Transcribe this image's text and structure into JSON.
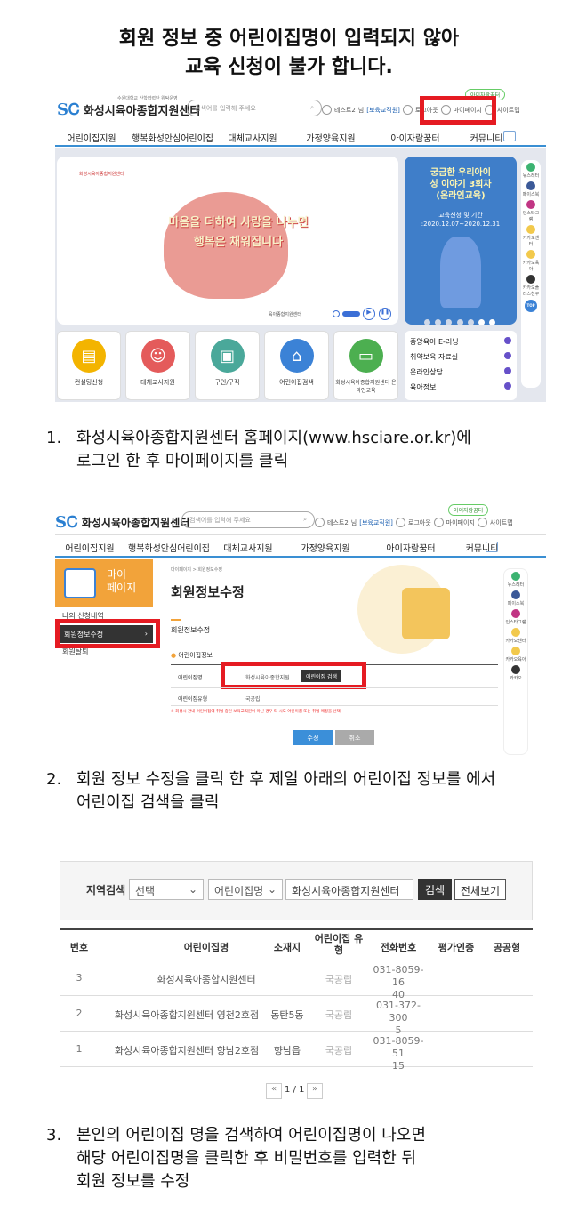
{
  "heading": {
    "line1": "회원 정보 중 어린이집명이 입력되지 않아",
    "line2": "교육 신청이 불가 합니다."
  },
  "site": {
    "logo_name": "화성시육아종합지원센터",
    "logo_tagline": "수원대학교 산학협력단 위탁운영",
    "search_placeholder": "검색어를 입력해 주세요",
    "user_name": "테스트2",
    "user_suffix": "님",
    "user_role": "[보육교직원]",
    "logout": "로그아웃",
    "mypage": "마이페이지",
    "sitemap": "사이트맵",
    "top_tag": "아이자람꿈터",
    "nav": [
      "어린이집지원",
      "행복화성안심어린이집",
      "대체교사지원",
      "가정양육지원",
      "아이자람꿈터",
      "커뮤니티"
    ]
  },
  "home": {
    "banner_logo": "화성시육아종합지원센터",
    "banner_line1": "마음을 더하여 사랑을 나누면",
    "banner_line2": "행복은 채워집니다",
    "banner_footer": "육아종합지원센터",
    "promo_line1": "궁금한 우리아이",
    "promo_line2": "성 이야기 3회차",
    "promo_line3": "(온라인교육)",
    "promo_period_label": "교육신청 및 기간",
    "promo_period": ":2020.12.07~2020.12.31",
    "quick": [
      "컨설팅신청",
      "대체교사지원",
      "구인/구직",
      "어린이집검색",
      "화성시육아종합지원센터 온라인교육"
    ],
    "side_links": [
      "중앙육아 E-러닝",
      "취약보육 자료실",
      "온라인상담",
      "육아정보"
    ],
    "right_bar": [
      "뉴스레터",
      "페이스북",
      "인스타그램",
      "카카오센터",
      "카카오육아",
      "카카오플러스친구",
      "TOP"
    ]
  },
  "step1": {
    "num": "1.",
    "line1": "화성시육아종합지원센터 홈페이지(www.hsciare.or.kr)에",
    "line2": "로그인 한 후 마이페이지를 클릭"
  },
  "mypage": {
    "side_title_1": "마이",
    "side_title_2": "페이지",
    "side_items": [
      "나의 신청내역",
      "회원정보수정",
      "회원탈퇴"
    ],
    "breadcrumb": "마이페이지  >  회원정보수정",
    "page_title": "회원정보수정",
    "section_title": "회원정보수정",
    "subsection": "어린이집정보",
    "field1_label": "어린이집명",
    "field1_value": "화성시육아종합지원",
    "field1_button": "어린이집 검색",
    "field2_label": "어린이집유형",
    "field2_value": "국공립",
    "notice": "※ 화성시 관내 어린이집에 취업 중인 보육교직원이 아닌 경우 타 시도 어린이집 또는 취업 예정을 선택",
    "submit": "수정",
    "cancel": "취소",
    "right_bar": [
      "뉴스레터",
      "페이스북",
      "인스타그램",
      "카카오센터",
      "카카오육아",
      "카카오"
    ]
  },
  "step2": {
    "num": "2.",
    "line1": "회원 정보 수정을 클릭 한 후 제일 아래의 어린이집 정보를 에서",
    "line2": "어린이집 검색을 클릭"
  },
  "search_panel": {
    "region_label": "지역검색",
    "region_select": "선택",
    "type_select": "어린이집명",
    "keyword": "화성시육아종합지원센터",
    "search_button": "검색",
    "all_button": "전체보기",
    "headers": [
      "번호",
      "어린이집명",
      "소재지",
      "어린이집 유형",
      "전화번호",
      "평가인증",
      "공공형"
    ],
    "rows": [
      {
        "no": "3",
        "name": "화성시육아종합지원센터",
        "loc": "",
        "type": "국공립",
        "tel1": "031-8059-16",
        "tel2": "40"
      },
      {
        "no": "2",
        "name": "화성시육아종합지원센터 영천2호점",
        "loc": "동탄5동",
        "type": "국공립",
        "tel1": "031-372-300",
        "tel2": "5"
      },
      {
        "no": "1",
        "name": "화성시육아종합지원센터 향남2호점",
        "loc": "향남읍",
        "type": "국공립",
        "tel1": "031-8059-51",
        "tel2": "15"
      }
    ],
    "pager": "1 / 1"
  },
  "step3": {
    "num": "3.",
    "line1": "본인의 어린이집 명을 검색하여 어린이집명이 나오면",
    "line2": "해당 어린이집명을 클릭한 후 비밀번호를 입력한 뒤",
    "line3": "회원 정보를 수정"
  }
}
